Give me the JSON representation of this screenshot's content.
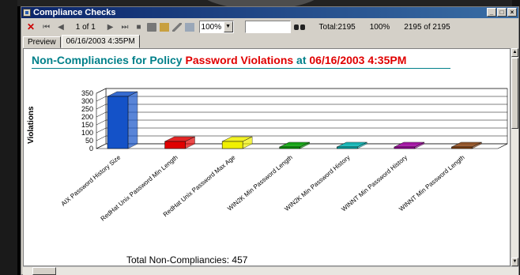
{
  "window": {
    "title": "Compliance Checks",
    "controls": [
      "_",
      "□",
      "×"
    ]
  },
  "toolbar": {
    "stop": "✕",
    "first": "⏮",
    "prev": "◀",
    "page_indicator": "1 of 1",
    "next": "▶",
    "last": "⏭",
    "stop_square": "■",
    "zoom": "100%",
    "search_value": "",
    "total": "Total:2195",
    "percent": "100%",
    "records": "2195 of 2195"
  },
  "tabs": [
    {
      "label": "Preview"
    },
    {
      "label": "06/16/2003  4:35PM"
    }
  ],
  "report": {
    "title_part1": "Non-Compliancies for Policy ",
    "title_policy": "Password Violations",
    "title_part2": " at ",
    "title_datetime": "06/16/2003    4:35PM",
    "total_label": "Total Non-Compliancies: 457"
  },
  "chart_data": {
    "type": "bar",
    "ylabel": "Violations",
    "xlabel": "",
    "ylim": [
      0,
      350
    ],
    "yticks": [
      0,
      50,
      100,
      150,
      200,
      250,
      300,
      350
    ],
    "categories": [
      "AIX Password History Size",
      "RedHat Unix Password Min Length",
      "RedHat Unix Password Max Age",
      "WIN2K Min Password Length",
      "WIN2K Min Password History",
      "WINNT Min Password History",
      "WINNT Min Password Length"
    ],
    "values": [
      330,
      45,
      45,
      10,
      10,
      10,
      10
    ],
    "colors": [
      "#1452c8",
      "#e00000",
      "#f0f000",
      "#00a000",
      "#00b4b4",
      "#a000a0",
      "#8b4513"
    ],
    "grid": true
  }
}
